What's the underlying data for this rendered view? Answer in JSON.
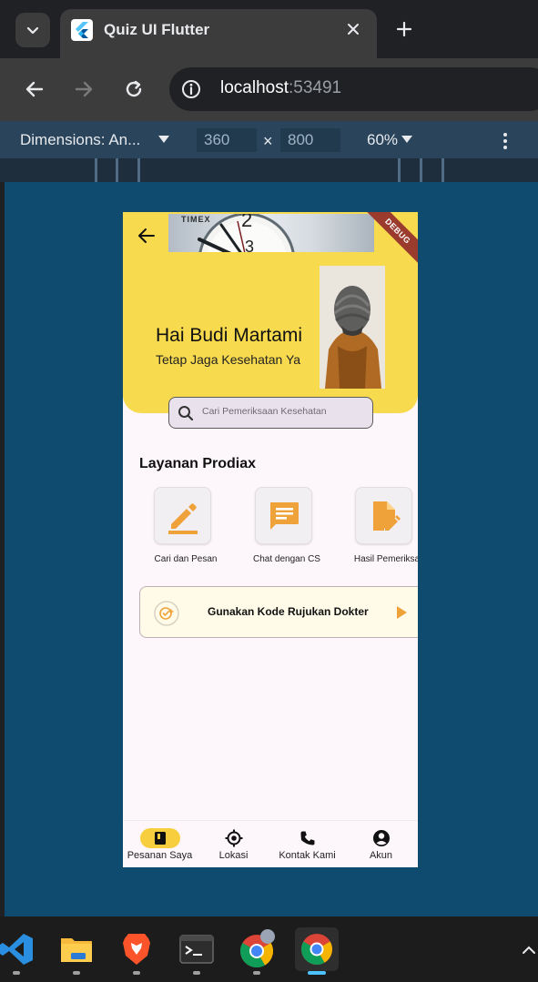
{
  "browser": {
    "tab_title": "Quiz UI Flutter",
    "url_host": "localhost",
    "url_port": ":53491",
    "devtools": {
      "dimensions_label": "Dimensions: An...",
      "width": "360",
      "height": "800",
      "times": "×",
      "zoom": "60%"
    }
  },
  "app": {
    "debug_banner": "DEBUG",
    "banner_brand": "TIMEX",
    "greeting": "Hai Budi Martami",
    "greeting_sub": "Tetap Jaga Kesehatan Ya",
    "search_placeholder": "Cari Pemeriksaan Kesehatan",
    "section_title": "Layanan Prodiax",
    "services": [
      {
        "label": "Cari dan Pesan",
        "icon": "edit-icon"
      },
      {
        "label": "Chat dengan CS",
        "icon": "chat-icon"
      },
      {
        "label": "Hasil Pemeriksa",
        "icon": "document-edit-icon"
      }
    ],
    "referral_label": "Gunakan Kode Rujukan Dokter",
    "bottom_nav": [
      {
        "label": "Pesanan Saya",
        "icon": "book-icon",
        "active": true
      },
      {
        "label": "Lokasi",
        "icon": "location-target-icon",
        "active": false
      },
      {
        "label": "Kontak Kami",
        "icon": "phone-icon",
        "active": false
      },
      {
        "label": "Akun",
        "icon": "account-icon",
        "active": false
      }
    ]
  },
  "colors": {
    "hero_yellow": "#f8da4e",
    "accent_orange": "#f0a23a",
    "nav_active": "#f7cf3e",
    "devtools_bar": "#29445b",
    "viewport_bg": "#0f4a6f"
  },
  "taskbar": {
    "apps": [
      "vscode-icon",
      "file-explorer-icon",
      "brave-icon",
      "terminal-icon",
      "chrome-profile-icon",
      "chrome-icon"
    ]
  }
}
